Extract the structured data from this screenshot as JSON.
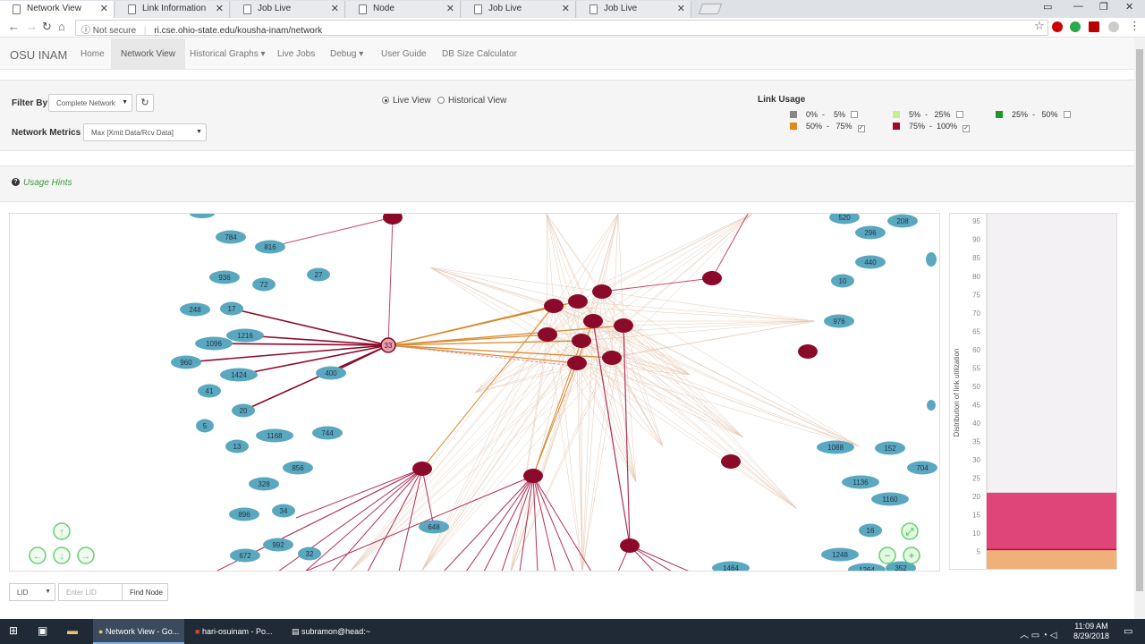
{
  "browser": {
    "tabs": [
      {
        "title": "Network View",
        "active": true
      },
      {
        "title": "Link Information",
        "active": false
      },
      {
        "title": "Job Live",
        "active": false
      },
      {
        "title": "Node",
        "active": false
      },
      {
        "title": "Job Live",
        "active": false
      },
      {
        "title": "Job Live",
        "active": false
      }
    ],
    "security_label": "Not secure",
    "url": "ri.cse.ohio-state.edu/kousha-inam/network"
  },
  "app": {
    "brand": "OSU INAM",
    "nav": [
      "Home",
      "Network View",
      "Historical Graphs",
      "Live Jobs",
      "Debug",
      "User Guide",
      "DB Size Calculator"
    ]
  },
  "controls": {
    "filter_label": "Filter By",
    "filter_value": "Complete Network",
    "metrics_label": "Network Metrics",
    "metrics_value": "Max [Xmit Data/Rcv Data]",
    "view_live": "Live View",
    "view_historical": "Historical View",
    "view_selected": "live"
  },
  "link_usage": {
    "title": "Link Usage",
    "ranges": [
      {
        "from": "0%",
        "to": "5%",
        "color": "#888888",
        "checked": false
      },
      {
        "from": "5%",
        "to": "25%",
        "color": "#c8ef8a",
        "checked": false
      },
      {
        "from": "25%",
        "to": "50%",
        "color": "#1e9a1e",
        "checked": false
      },
      {
        "from": "50%",
        "to": "75%",
        "color": "#e08a1e",
        "checked": true
      },
      {
        "from": "75%",
        "to": "100%",
        "color": "#9b0a2a",
        "checked": true
      }
    ]
  },
  "hints": {
    "label": "Usage Hints"
  },
  "network": {
    "highlighted_node": "33",
    "switch_color": "#8b0a2a",
    "host_color": "#5aa8c0",
    "host_labels": [
      "784",
      "816",
      "936",
      "72",
      "27",
      "248",
      "17",
      "1216",
      "1096",
      "960",
      "1424",
      "400",
      "41",
      "20",
      "5",
      "13",
      "1168",
      "744",
      "856",
      "328",
      "896",
      "34",
      "672",
      "992",
      "32",
      "648",
      "520",
      "208",
      "296",
      "440",
      "10",
      "976",
      "1088",
      "152",
      "704",
      "1136",
      "1160",
      "16",
      "1248",
      "1264",
      "352",
      "1464"
    ]
  },
  "chart_data": {
    "type": "bar",
    "ylabel": "Distribution of link utilization",
    "yticks": [
      5,
      10,
      15,
      20,
      25,
      30,
      35,
      40,
      45,
      50,
      55,
      60,
      65,
      70,
      75,
      80,
      85,
      90,
      95
    ],
    "ylim": [
      0,
      97
    ],
    "series": [
      {
        "name": "50% - 75%",
        "color": "#f0b07a",
        "from": 0,
        "to": 5.5
      },
      {
        "name": "75% - 100%",
        "color": "#e0457a",
        "from": 5.5,
        "to": 21
      }
    ]
  },
  "find": {
    "type_value": "LID",
    "placeholder": "Enter LID",
    "button": "Find Node"
  },
  "taskbar": {
    "items": [
      "Network View - Go...",
      "hari-osuinam - Po...",
      "subramon@head:~"
    ],
    "time": "11:09 AM",
    "date": "8/29/2018"
  }
}
